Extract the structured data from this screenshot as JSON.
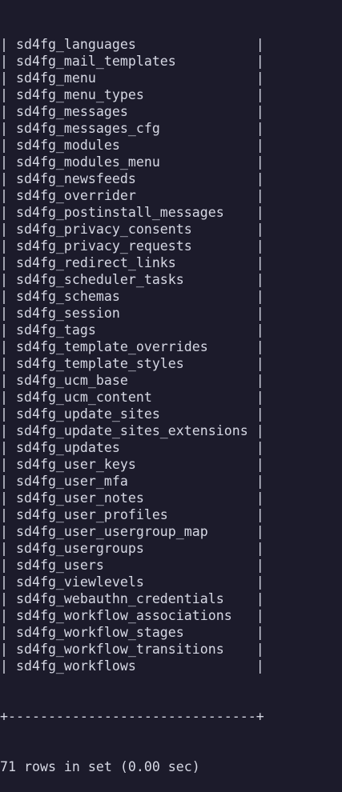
{
  "terminal": {
    "table_rows": [
      "sd4fg_languages",
      "sd4fg_mail_templates",
      "sd4fg_menu",
      "sd4fg_menu_types",
      "sd4fg_messages",
      "sd4fg_messages_cfg",
      "sd4fg_modules",
      "sd4fg_modules_menu",
      "sd4fg_newsfeeds",
      "sd4fg_overrider",
      "sd4fg_postinstall_messages",
      "sd4fg_privacy_consents",
      "sd4fg_privacy_requests",
      "sd4fg_redirect_links",
      "sd4fg_scheduler_tasks",
      "sd4fg_schemas",
      "sd4fg_session",
      "sd4fg_tags",
      "sd4fg_template_overrides",
      "sd4fg_template_styles",
      "sd4fg_ucm_base",
      "sd4fg_ucm_content",
      "sd4fg_update_sites",
      "sd4fg_update_sites_extensions",
      "sd4fg_updates",
      "sd4fg_user_keys",
      "sd4fg_user_mfa",
      "sd4fg_user_notes",
      "sd4fg_user_profiles",
      "sd4fg_user_usergroup_map",
      "sd4fg_usergroups",
      "sd4fg_users",
      "sd4fg_viewlevels",
      "sd4fg_webauthn_credentials",
      "sd4fg_workflow_associations",
      "sd4fg_workflow_stages",
      "sd4fg_workflow_transitions",
      "sd4fg_workflows"
    ],
    "column_width": 29,
    "summary": "71 rows in set (0.00 sec)"
  },
  "colors": {
    "background": "#1c1b2b",
    "text": "#d6d8e4"
  }
}
